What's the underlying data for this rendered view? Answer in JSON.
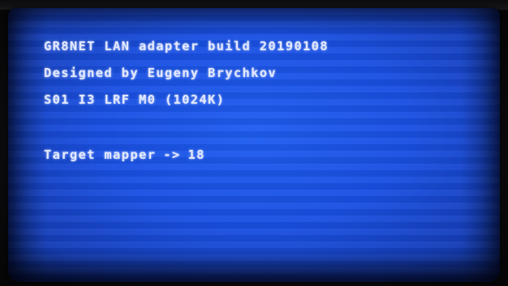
{
  "screen": {
    "background_color": "#1a50e2",
    "text_color": "#e2e8ff",
    "lines": [
      "GR8NET LAN adapter build 20190108",
      "Designed by Eugeny Brychkov",
      "S01 I3 LRF M0 (1024K)"
    ],
    "mapper": {
      "label": "Target mapper",
      "arrow": "->",
      "value": "18"
    }
  }
}
